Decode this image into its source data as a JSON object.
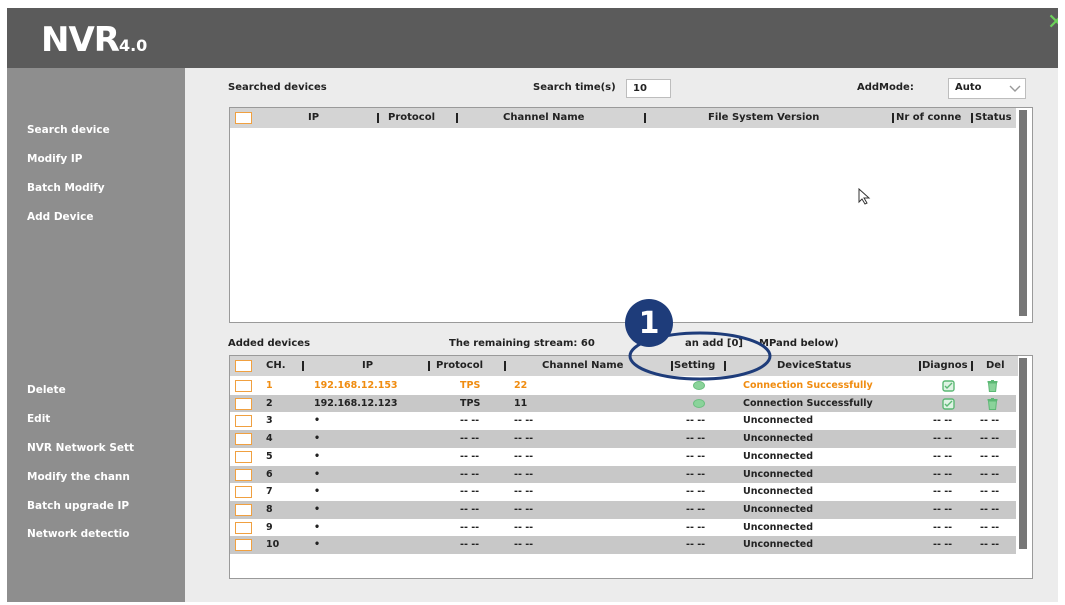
{
  "app": {
    "logo_main": "NVR",
    "logo_version": "4.0"
  },
  "sidebar": {
    "top_items": [
      "Search device",
      "Modify IP",
      "Batch Modify",
      "Add Device"
    ],
    "bottom_items": [
      "Delete",
      "Edit",
      "NVR Network Sett",
      "Modify the chann",
      "Batch upgrade IP",
      "Network detectio"
    ]
  },
  "searched": {
    "title": "Searched devices",
    "search_time_label": "Search time(s)",
    "search_time_value": "10",
    "addmode_label": "AddMode:",
    "addmode_value": "Auto",
    "columns": [
      "IP",
      "Protocol",
      "Channel Name",
      "File System Version",
      "Nr of conne",
      "Status"
    ]
  },
  "added": {
    "title": "Added devices",
    "remaining_stream": "The remaining stream: 60",
    "can_add": "an add [0]",
    "mp_text": "MPand below)",
    "callout_number": "1",
    "columns": [
      "CH.",
      "IP",
      "Protocol",
      "Channel Name",
      "Setting",
      "DeviceStatus",
      "Diagnos",
      "Del"
    ],
    "rows": [
      {
        "ch": "1",
        "ip": "192.168.12.153",
        "protocol": "TPS",
        "channel_name": "22",
        "setting": "",
        "status": "Connection Successfully",
        "diagnose": "",
        "del": ""
      },
      {
        "ch": "2",
        "ip": "192.168.12.123",
        "protocol": "TPS",
        "channel_name": "11",
        "setting": "",
        "status": "Connection Successfully",
        "diagnose": "",
        "del": ""
      },
      {
        "ch": "3",
        "ip": "•",
        "protocol": "-- --",
        "channel_name": "-- --",
        "setting": "-- --",
        "status": "Unconnected",
        "diagnose": "-- --",
        "del": "-- --"
      },
      {
        "ch": "4",
        "ip": "•",
        "protocol": "-- --",
        "channel_name": "-- --",
        "setting": "-- --",
        "status": "Unconnected",
        "diagnose": "-- --",
        "del": "-- --"
      },
      {
        "ch": "5",
        "ip": "•",
        "protocol": "-- --",
        "channel_name": "-- --",
        "setting": "-- --",
        "status": "Unconnected",
        "diagnose": "-- --",
        "del": "-- --"
      },
      {
        "ch": "6",
        "ip": "•",
        "protocol": "-- --",
        "channel_name": "-- --",
        "setting": "-- --",
        "status": "Unconnected",
        "diagnose": "-- --",
        "del": "-- --"
      },
      {
        "ch": "7",
        "ip": "•",
        "protocol": "-- --",
        "channel_name": "-- --",
        "setting": "-- --",
        "status": "Unconnected",
        "diagnose": "-- --",
        "del": "-- --"
      },
      {
        "ch": "8",
        "ip": "•",
        "protocol": "-- --",
        "channel_name": "-- --",
        "setting": "-- --",
        "status": "Unconnected",
        "diagnose": "-- --",
        "del": "-- --"
      },
      {
        "ch": "9",
        "ip": "•",
        "protocol": "-- --",
        "channel_name": "-- --",
        "setting": "-- --",
        "status": "Unconnected",
        "diagnose": "-- --",
        "del": "-- --"
      },
      {
        "ch": "10",
        "ip": "•",
        "protocol": "-- --",
        "channel_name": "-- --",
        "setting": "-- --",
        "status": "Unconnected",
        "diagnose": "-- --",
        "del": "-- --"
      }
    ]
  },
  "colors": {
    "titlebar": "#5b5b5b",
    "sidebar": "#8e8e8e",
    "accent_orange": "#f08c10",
    "callout_blue": "#1e3c7a",
    "icon_green": "#6cbf80",
    "close_green": "#6cd15a"
  }
}
